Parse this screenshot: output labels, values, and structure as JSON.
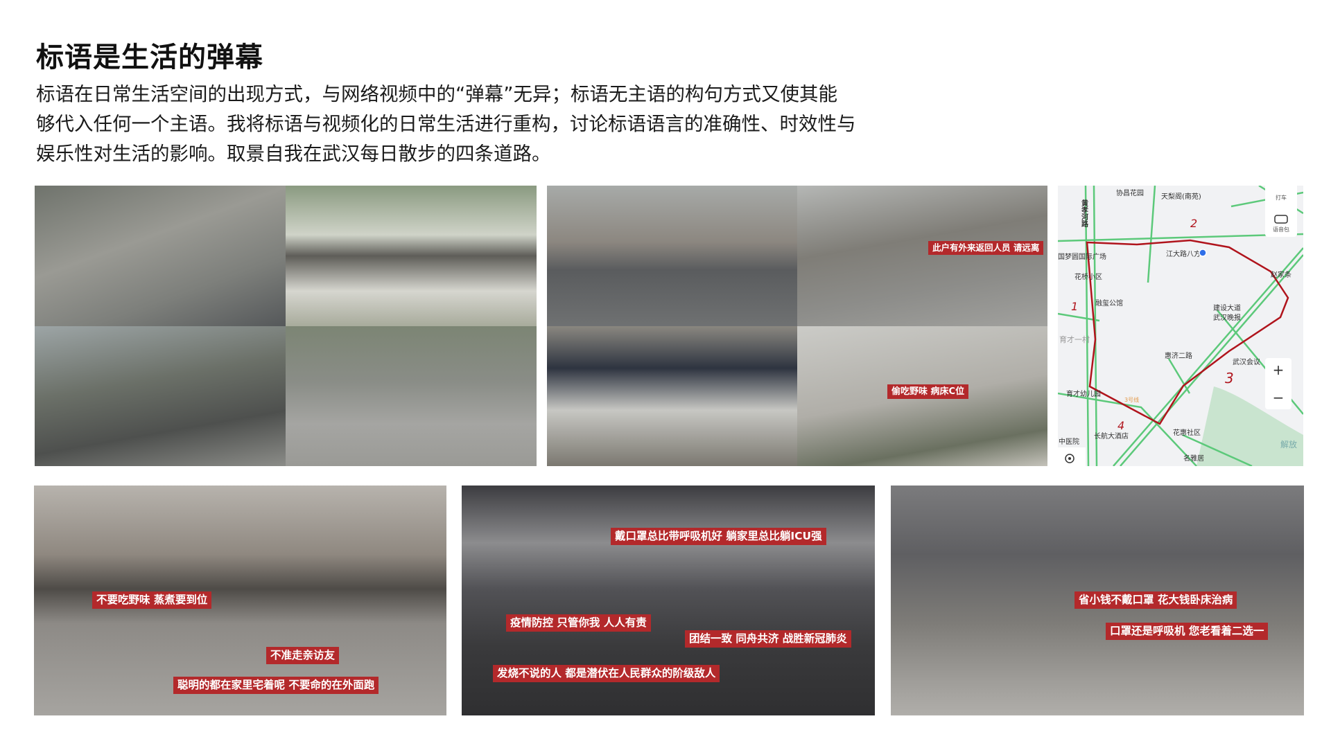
{
  "header": {
    "title": "标语是生活的弹幕",
    "paragraph_lines": [
      "标语在日常生活空间的出现方式，与网络视频中的“弹幕”无异；标语无主语的构句方式又使其能",
      "够代入任何一个主语。我将标语与视频化的日常生活进行重构，讨论标语语言的准确性、时效性与",
      "娱乐性对生活的影响。取景自我在武汉每日散步的四条道路。"
    ]
  },
  "top_row": {
    "panel_street_1": {
      "captions": []
    },
    "panel_street_2": {
      "captions": [
        "此户有外来返回人员 请远离",
        "偷吃野味 病床C位"
      ]
    },
    "map": {
      "labels": [
        "协昌花园",
        "天梨阁(南苑)",
        "黄孝河路",
        "国梦圆国际广场",
        "江大路八方",
        "赵家条",
        "花桥小区",
        "融玺公馆",
        "建设大道",
        "武汉晚报",
        "育才一村",
        "惠济二路",
        "武汉会议",
        "育才幼儿园",
        "3号线",
        "长航大酒店",
        "花惠社区",
        "中医院",
        "名雅居",
        "解放",
        "打车",
        "语音包"
      ],
      "route_numbers": [
        "1",
        "2",
        "3",
        "4"
      ],
      "zoom_in": "+",
      "zoom_out": "−",
      "route_color": "#b0141c",
      "road_color": "#5cc97a"
    }
  },
  "bottom_row": {
    "panel_dog": {
      "captions": [
        "不要吃野味 蒸煮要到位",
        "不准走亲访友",
        "聪明的都在家里宅着呢 不要命的在外面跑"
      ]
    },
    "panel_night": {
      "captions": [
        "戴口罩总比带呼吸机好 躺家里总比躺ICU强",
        "疫情防控 只管你我 人人有责",
        "团结一致 同舟共济 战胜新冠肺炎",
        "发烧不说的人 都是潜伏在人民群众的阶级敌人"
      ]
    },
    "panel_shop": {
      "captions": [
        "省小钱不戴口罩 花大钱卧床治病",
        "口罩还是呼吸机 您老看着二选一"
      ]
    }
  },
  "colors": {
    "caption_bg": "#b3292b",
    "caption_text": "#ffffff"
  }
}
